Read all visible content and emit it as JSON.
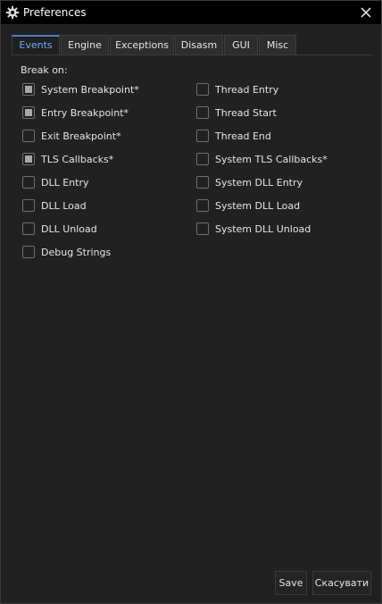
{
  "window": {
    "title": "Preferences",
    "icon": "gear-icon",
    "close_icon": "close-icon"
  },
  "tabs": [
    {
      "label": "Events",
      "active": true
    },
    {
      "label": "Engine",
      "active": false
    },
    {
      "label": "Exceptions",
      "active": false
    },
    {
      "label": "Disasm",
      "active": false
    },
    {
      "label": "GUI",
      "active": false
    },
    {
      "label": "Misc",
      "active": false
    }
  ],
  "events": {
    "group_label": "Break on:",
    "left_column": [
      {
        "label": "System Breakpoint*",
        "checked": true
      },
      {
        "label": "Entry Breakpoint*",
        "checked": true
      },
      {
        "label": "Exit Breakpoint*",
        "checked": false
      },
      {
        "label": "TLS Callbacks*",
        "checked": true
      },
      {
        "label": "DLL Entry",
        "checked": false
      },
      {
        "label": "DLL Load",
        "checked": false
      },
      {
        "label": "DLL Unload",
        "checked": false
      },
      {
        "label": "Debug Strings",
        "checked": false
      }
    ],
    "right_column": [
      {
        "label": "Thread Entry",
        "checked": false
      },
      {
        "label": "Thread Start",
        "checked": false
      },
      {
        "label": "Thread End",
        "checked": false
      },
      {
        "label": "System TLS Callbacks*",
        "checked": false
      },
      {
        "label": "System DLL Entry",
        "checked": false
      },
      {
        "label": "System DLL Load",
        "checked": false
      },
      {
        "label": "System DLL Unload",
        "checked": false
      }
    ]
  },
  "buttons": {
    "save_label": "Save",
    "cancel_label": "Скасувати"
  },
  "colors": {
    "background": "#212121",
    "titlebar": "#000000",
    "active_tab_text": "#6fa8ff",
    "text": "#e6e6e6"
  }
}
